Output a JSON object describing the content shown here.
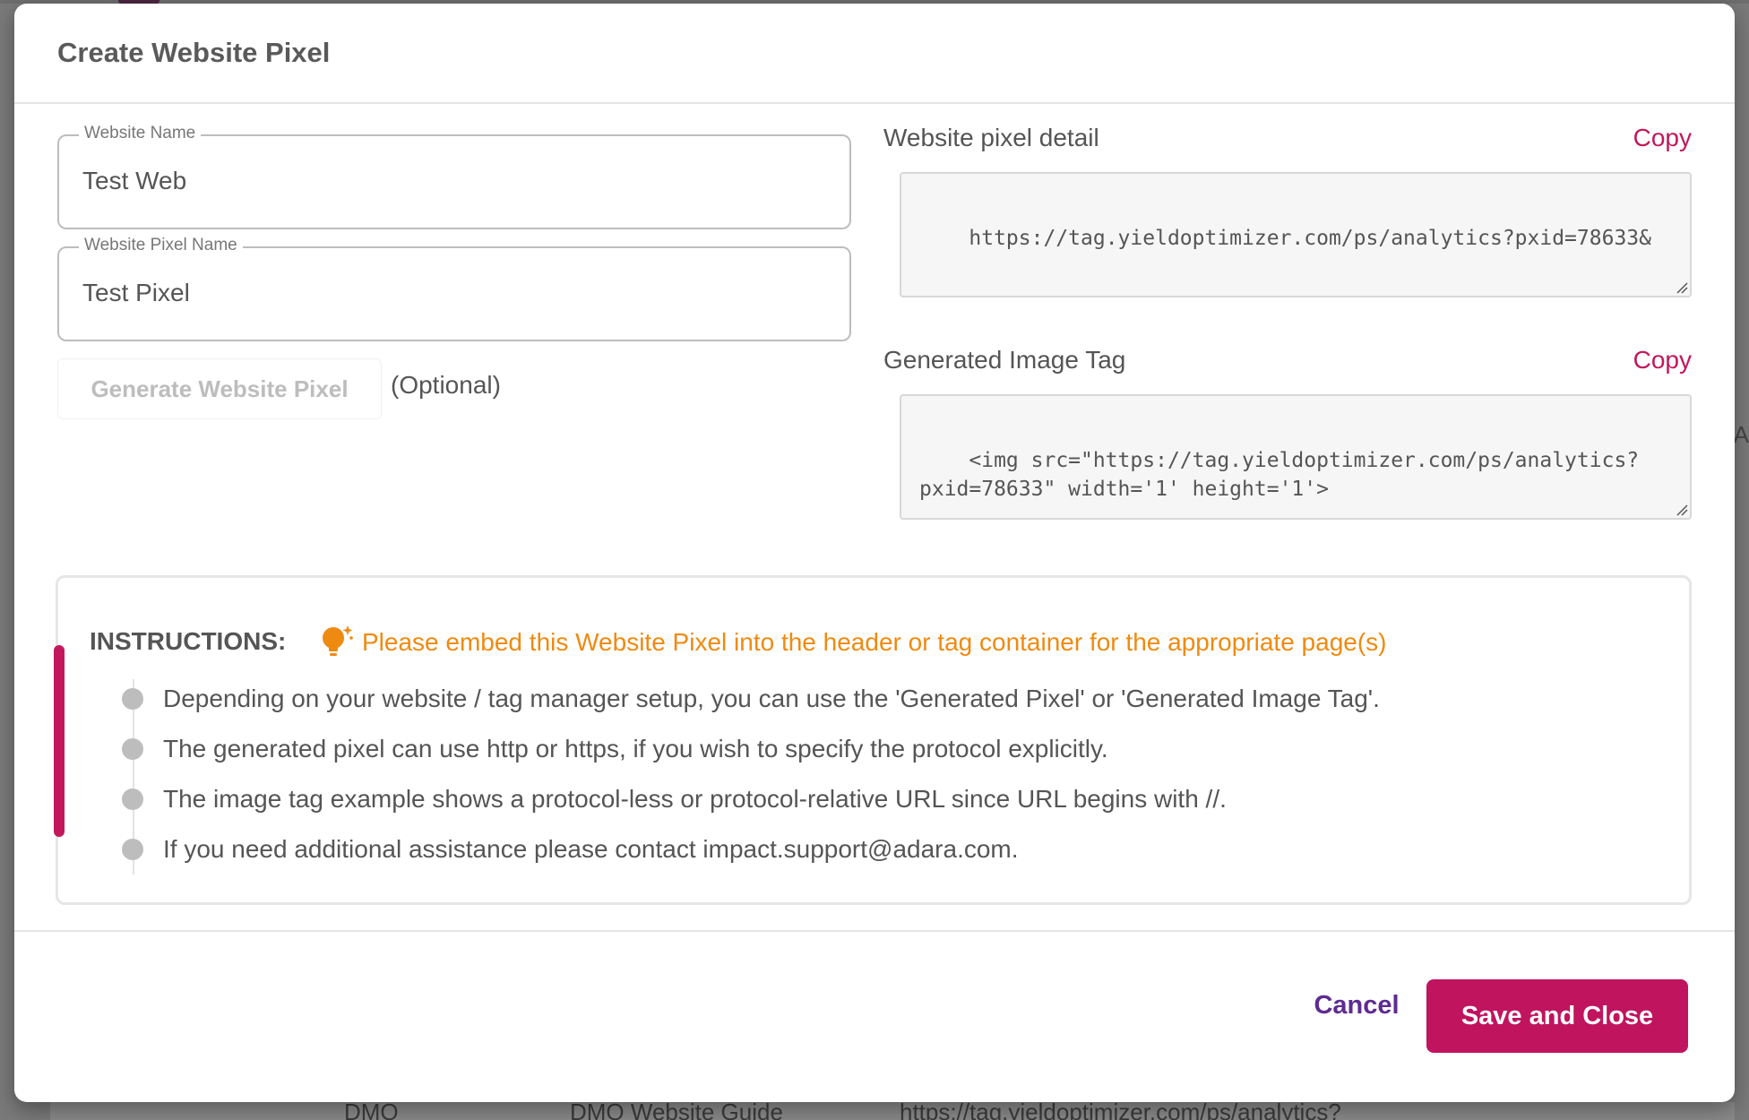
{
  "background": {
    "row_name": "DMO Website  Guide",
    "row_url": "https://tag.yieldoptimizer.com/ps/analytics?",
    "row_short": "DMO",
    "side_glyph": "A"
  },
  "dialog": {
    "title": "Create Website Pixel"
  },
  "form": {
    "website_name": {
      "label": "Website Name",
      "value": "Test Web"
    },
    "pixel_name": {
      "label": "Website Pixel Name",
      "value": "Test Pixel"
    },
    "generate_button": "Generate Website Pixel",
    "optional_label": "(Optional)"
  },
  "pixel_detail": {
    "label": "Website pixel detail",
    "copy_label": "Copy",
    "value": "https://tag.yieldoptimizer.com/ps/analytics?pxid=78633&"
  },
  "image_tag": {
    "label": "Generated Image Tag",
    "copy_label": "Copy",
    "value": "<img src=\"https://tag.yieldoptimizer.com/ps/analytics?\npxid=78633\" width='1' height='1'>"
  },
  "instructions": {
    "title": "INSTRUCTIONS:",
    "note": "Please embed this Website Pixel into the header or tag container for the appropriate page(s)",
    "items": [
      "Depending on your website / tag manager setup, you can use the 'Generated Pixel' or 'Generated Image Tag'.",
      "The generated pixel can use http or https, if you wish to specify the protocol explicitly.",
      "The image tag example shows a protocol-less or protocol-relative URL since URL begins with //.",
      "If you need additional assistance please contact impact.support@adara.com."
    ]
  },
  "footer": {
    "cancel_label": "Cancel",
    "save_label": "Save and Close"
  },
  "colors": {
    "accent": "#c0145f",
    "note_orange": "#ef8a10",
    "cancel_purple": "#5e2b91"
  }
}
